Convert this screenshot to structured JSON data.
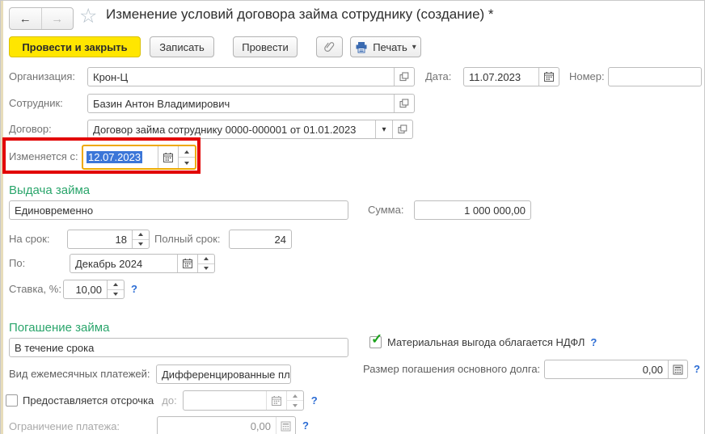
{
  "colors": {
    "accent_yellow": "#ffe600",
    "section_green": "#2aa56b",
    "selection_blue": "#3b76d8",
    "annotation_red": "#e20000",
    "focus_orange": "#efa900",
    "help_blue": "#2b6cd4"
  },
  "icons": {
    "back": "←",
    "forward": "→",
    "star": "☆",
    "dropdown": "▾",
    "check": "✓"
  },
  "header": {
    "title": "Изменение условий договора займа сотруднику (создание) *"
  },
  "toolbar": {
    "post_and_close": "Провести и закрыть",
    "save": "Записать",
    "post": "Провести",
    "print": "Печать"
  },
  "doc": {
    "org_label": "Организация:",
    "org_value": "Крон-Ц",
    "date_label": "Дата:",
    "date_value": "11.07.2023",
    "number_label": "Номер:",
    "number_value": "",
    "employee_label": "Сотрудник:",
    "employee_value": "Базин Антон Владимирович",
    "contract_label": "Договор:",
    "contract_value": "Договор займа сотруднику 0000-000001 от 01.01.2023",
    "change_from_label": "Изменяется с:",
    "change_from_value": "12.07.2023"
  },
  "issue": {
    "section_title": "Выдача займа",
    "method_value": "Единовременно",
    "amount_label": "Сумма:",
    "amount_value": "1 000 000,00",
    "term_label": "На срок:",
    "term_value": "18",
    "full_term_label": "Полный срок:",
    "full_term_value": "24",
    "until_label": "По:",
    "until_value": "Декабрь 2024",
    "rate_label": "Ставка, %:",
    "rate_value": "10,00"
  },
  "repayment": {
    "section_title": "Погашение займа",
    "method_value": "В течение срока",
    "monthly_kind_label": "Вид ежемесячных платежей:",
    "monthly_kind_value": "Дифференцированные пл",
    "material_benefit_label": "Материальная выгода облагается НДФЛ",
    "principal_label": "Размер погашения основного долга:",
    "principal_value": "0,00",
    "deferral_label": "Предоставляется отсрочка",
    "deferral_until_label": "до:",
    "deferral_until_value": "",
    "payment_limit_label": "Ограничение платежа:",
    "payment_limit_value": "0,00"
  },
  "help_mark": "?"
}
